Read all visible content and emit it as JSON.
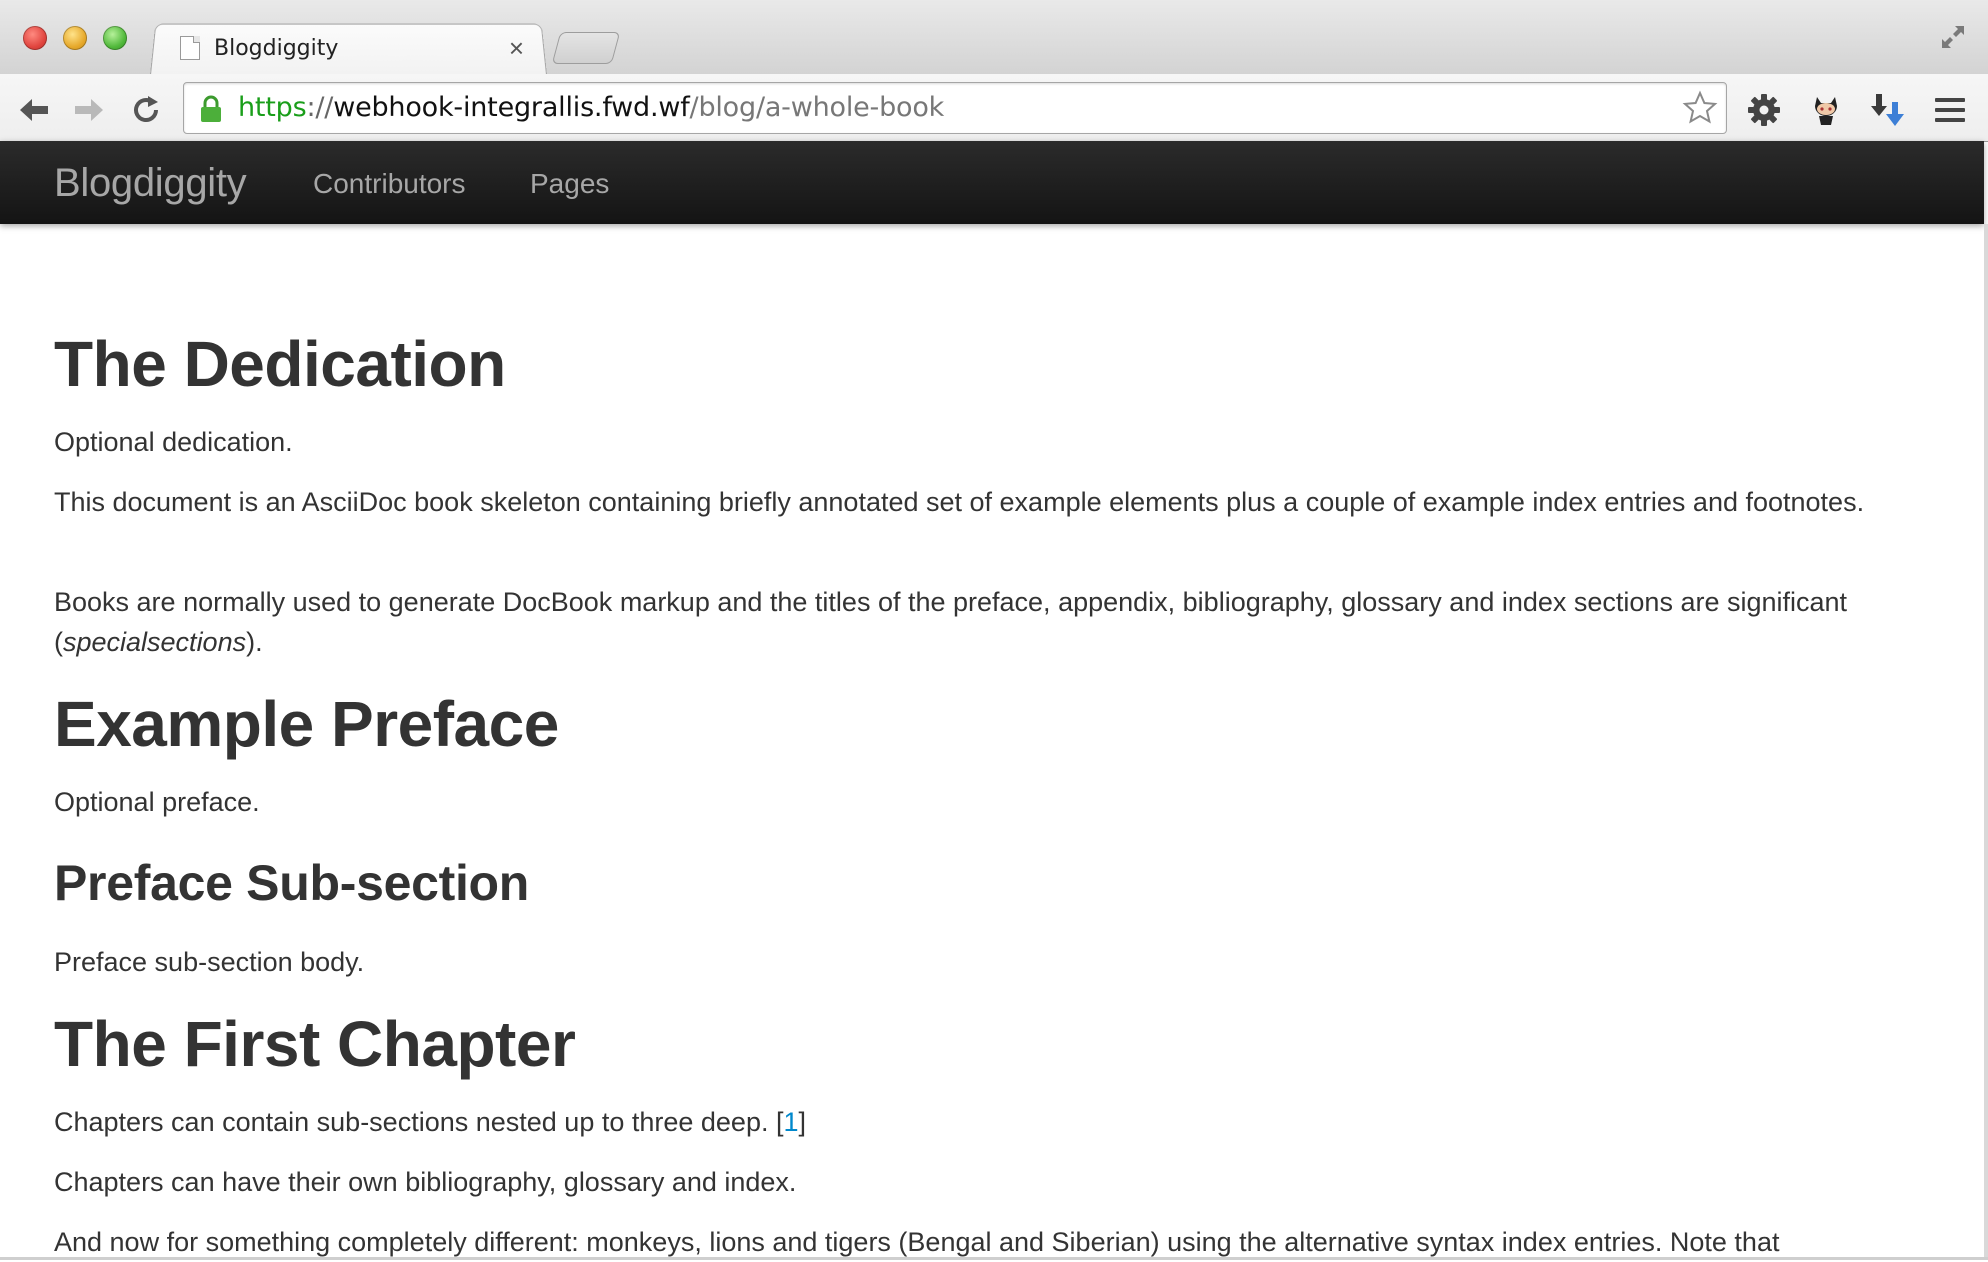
{
  "browser": {
    "tab_title": "Blogdiggity",
    "tab_close": "×",
    "url": {
      "scheme": "https",
      "separator": "://",
      "host": "webhook-integrallis.fwd.wf",
      "path": "/blog/a-whole-book"
    },
    "icons": [
      "back-icon",
      "forward-icon",
      "reload-icon",
      "lock-icon",
      "star-icon",
      "gear-icon",
      "octocat-icon",
      "download-icon",
      "menu-icon",
      "fullscreen-icon"
    ]
  },
  "navbar": {
    "brand": "Blogdiggity",
    "links": [
      "Contributors",
      "Pages"
    ]
  },
  "article": {
    "dedication_heading": "The Dedication",
    "dedication_text": "Optional dedication.",
    "intro_para": "This document is an AsciiDoc book skeleton containing briefly annotated set of example elements plus a couple of example index entries and footnotes.",
    "books_para_before": "Books are normally used to generate DocBook markup and the titles of the preface, appendix, bibliography, glossary and index sections are significant (",
    "books_para_em": "specialsections",
    "books_para_after": ").",
    "preface_heading": "Example Preface",
    "preface_text": "Optional preface.",
    "subsection_heading": "Preface Sub-section",
    "subsection_text": "Preface sub-section body.",
    "chapter_heading": "The First Chapter",
    "chapter_para1_before": "Chapters can contain sub-sections nested up to three deep. [",
    "chapter_para1_ref": "1",
    "chapter_para1_after": "]",
    "chapter_para2": "Chapters can have their own bibliography, glossary and index.",
    "chapter_para3": "And now for something completely different: monkeys, lions and tigers (Bengal and Siberian) using the alternative syntax index entries. Note that"
  },
  "colors": {
    "navbar_bg": "#1b1b1b",
    "nav_text": "#a7a7a7",
    "body_text": "#333333",
    "link": "#0088cc",
    "url_scheme": "#1a9e1a"
  }
}
